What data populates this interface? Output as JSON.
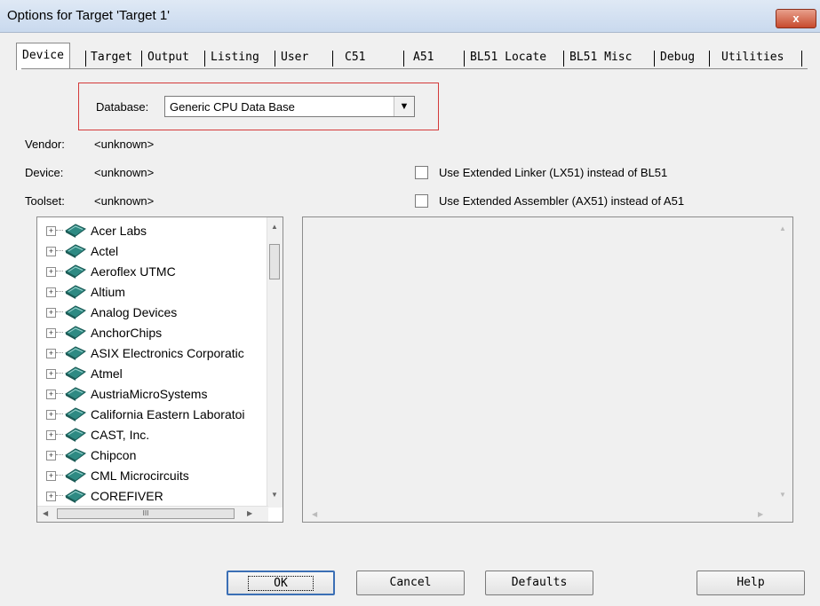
{
  "window": {
    "title": "Options for Target 'Target 1'",
    "close_label": "x"
  },
  "tabs": [
    "Device",
    "Target",
    "Output",
    "Listing",
    "User",
    "C51",
    "A51",
    "BL51 Locate",
    "BL51 Misc",
    "Debug",
    "Utilities"
  ],
  "database": {
    "label": "Database:",
    "value": "Generic CPU Data Base"
  },
  "info": {
    "vendor_label": "Vendor:",
    "vendor_value": "<unknown>",
    "device_label": "Device:",
    "device_value": "<unknown>",
    "toolset_label": "Toolset:",
    "toolset_value": "<unknown>"
  },
  "options": {
    "lx51_label": "Use Extended Linker (LX51) instead of BL51",
    "ax51_label": "Use Extended Assembler (AX51) instead of A51",
    "lx51_checked": false,
    "ax51_checked": false
  },
  "vendors": [
    "Acer Labs",
    "Actel",
    "Aeroflex UTMC",
    "Altium",
    "Analog Devices",
    "AnchorChips",
    "ASIX Electronics Corporatic",
    "Atmel",
    "AustriaMicroSystems",
    "California Eastern Laboratoi",
    "CAST, Inc.",
    "Chipcon",
    "CML Microcircuits",
    "COREFIVER"
  ],
  "scrollbar": {
    "hthumb_grip": "III"
  },
  "buttons": {
    "ok": "OK",
    "cancel": "Cancel",
    "defaults": "Defaults",
    "help": "Help"
  },
  "icons": {
    "tree_expand": "plus-box-icon",
    "vendor": "book-icon",
    "dropdown": "chevron-down-icon"
  }
}
